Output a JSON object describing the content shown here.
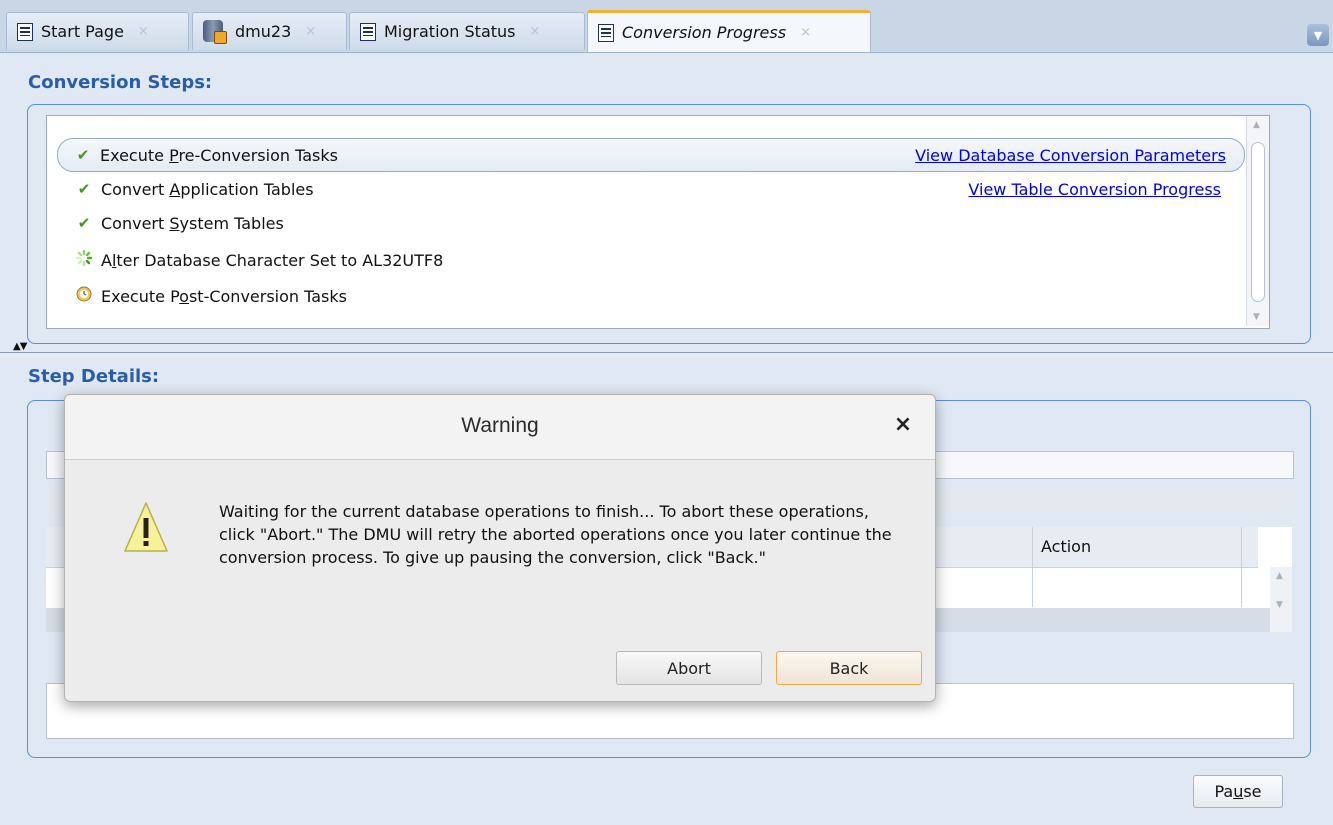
{
  "tabs": [
    {
      "label": "Start Page",
      "icon": "doc-icon",
      "active": false
    },
    {
      "label": "dmu23",
      "icon": "database-icon",
      "active": false
    },
    {
      "label": "Migration Status",
      "icon": "doc-icon",
      "active": false
    },
    {
      "label": "Conversion Progress",
      "icon": "doc-icon",
      "active": true
    }
  ],
  "tab_close_glyph": "×",
  "conversion_steps": {
    "title": "Conversion Steps:",
    "steps": [
      {
        "pre": "Execute ",
        "mnemonic": "P",
        "post": "re-Conversion Tasks",
        "status": "complete",
        "link": "View Database Conversion Parameters"
      },
      {
        "pre": "Convert ",
        "mnemonic": "A",
        "post": "pplication Tables",
        "status": "complete",
        "link": "View Table Conversion Progress"
      },
      {
        "pre": "Convert ",
        "mnemonic": "S",
        "post": "ystem Tables",
        "status": "complete"
      },
      {
        "pre": "A",
        "mnemonic": "l",
        "post": "ter Database Character Set to AL32UTF8",
        "status": "in-progress"
      },
      {
        "pre": "Execute P",
        "mnemonic": "o",
        "post": "st-Conversion Tasks",
        "status": "pending"
      }
    ]
  },
  "step_details": {
    "title": "Step Details:",
    "table_header_action": "Action"
  },
  "pause_button": {
    "pre": "Pa",
    "mnemonic": "u",
    "post": "se"
  },
  "dialog": {
    "title": "Warning",
    "message": "Waiting for the current database operations to finish... To abort these operations, click \"Abort.\" The DMU will retry the aborted operations once you later continue the conversion process. To give up pausing the conversion, click \"Back.\"",
    "abort_label": "Abort",
    "back_label": "Back"
  },
  "colors": {
    "accent": "#2a5da8",
    "panel_border": "#5b8fd6",
    "active_tab_top": "#f2b132",
    "default_button_border": "#f0a848",
    "link": "#0000ee"
  }
}
